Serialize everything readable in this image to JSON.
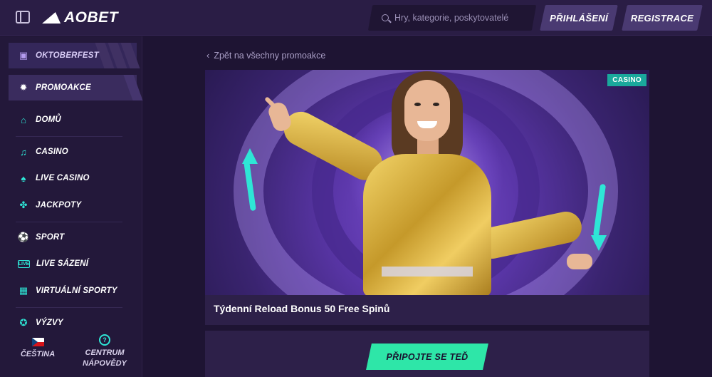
{
  "header": {
    "logo_text": "AOBET",
    "search_placeholder": "Hry, kategorie, poskytovatelé",
    "login_label": "PŘIHLÁŠENÍ",
    "register_label": "REGISTRACE"
  },
  "sidebar": {
    "items": [
      {
        "label": "OKTOBERFEST",
        "icon": "beer-mug-icon"
      },
      {
        "label": "PROMOAKCE",
        "icon": "percent-badge-icon"
      },
      {
        "label": "DOMŮ",
        "icon": "home-icon"
      },
      {
        "label": "CASINO",
        "icon": "music-note-icon"
      },
      {
        "label": "LIVE CASINO",
        "icon": "cards-icon"
      },
      {
        "label": "JACKPOTY",
        "icon": "clover-icon"
      },
      {
        "label": "SPORT",
        "icon": "sport-ball-icon"
      },
      {
        "label": "LIVE SÁZENÍ",
        "icon": "live-badge-icon"
      },
      {
        "label": "VIRTUÁLNÍ SPORTY",
        "icon": "virtual-sport-icon"
      },
      {
        "label": "VÝZVY",
        "icon": "medal-icon"
      }
    ],
    "language_label": "ČEŠTINA",
    "help_label_line1": "CENTRUM",
    "help_label_line2": "NÁPOVĚDY"
  },
  "main": {
    "back_link": "Zpět na všechny promoakce",
    "promo": {
      "tag": "CASINO",
      "title": "Týdenní Reload Bonus 50 Free Spinů"
    },
    "cta_label": "PŘIPOJTE SE TEĎ"
  },
  "colors": {
    "accent_teal": "#2ee6d6",
    "cta_green": "#2ee6a8",
    "background": "#1e1433",
    "header_bg": "#2a1d45"
  }
}
